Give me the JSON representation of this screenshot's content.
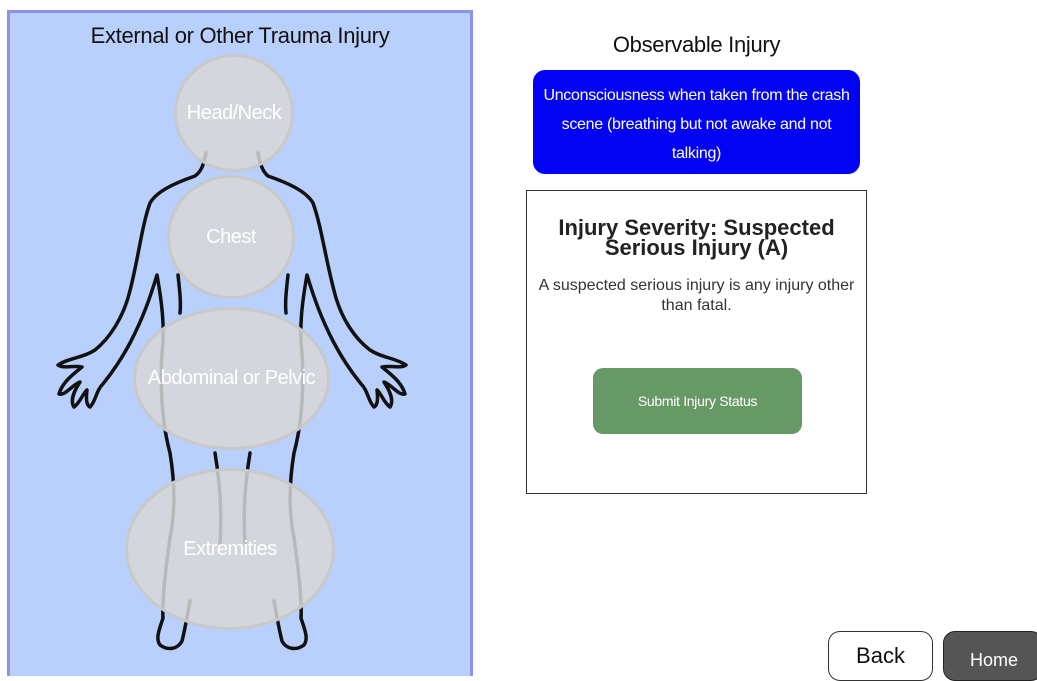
{
  "body_map": {
    "title": "External or Other Trauma Injury",
    "zones": {
      "head_neck": "Head/Neck",
      "chest": "Chest",
      "abdominal_pelvic": "Abdominal or Pelvic",
      "extremities": "Extremities"
    }
  },
  "observable": {
    "title": "Observable Injury",
    "selected_label": "Unconsciousness when taken from the crash scene (breathing but not awake and not talking)"
  },
  "severity": {
    "title": "Injury Severity: Suspected Serious Injury (A)",
    "description": "A suspected serious injury is any injury other than fatal.",
    "submit_label": "Submit Injury Status"
  },
  "nav": {
    "back_label": "Back",
    "home_label": "Home"
  },
  "colors": {
    "panel_bg": "#b8d0fb",
    "panel_border": "#8c92ea",
    "selected_button": "#0303f3",
    "submit_button": "#679966",
    "home_button": "#555555"
  }
}
